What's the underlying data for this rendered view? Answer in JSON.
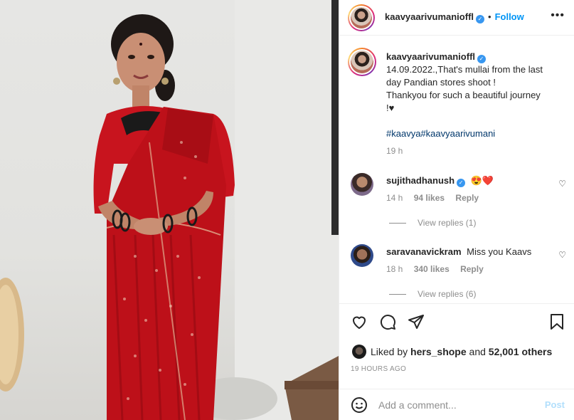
{
  "post": {
    "username": "kaavyaarivumanioffl",
    "follow_label": "Follow",
    "more_label": "•••",
    "caption": {
      "line1": "14.09.2022.,That's mullai from the last",
      "line2": "day Pandian stores shoot !",
      "line3": "Thankyou for such a beautiful journey",
      "line4": "!♥",
      "hashtags": "#kaavya#kaavyaarivumani",
      "time": "19 h"
    },
    "comments": [
      {
        "username": "sujithadhanush",
        "text": "😍❤️",
        "time": "14 h",
        "likes": "94 likes",
        "reply": "Reply",
        "view_replies": "View replies (1)"
      },
      {
        "username": "saravanavickram",
        "text": "Miss you Kaavs",
        "time": "18 h",
        "likes": "340 likes",
        "reply": "Reply",
        "view_replies": "View replies (6)"
      }
    ],
    "likes": {
      "prefix": "Liked by",
      "user": "hers_shope",
      "connector": "and",
      "others": "52,001 others"
    },
    "posted_ago": "19 HOURS AGO",
    "comment_placeholder": "Add a comment...",
    "post_label": "Post"
  },
  "colors": {
    "accent": "#0095f6",
    "verified": "#3897f0",
    "saree_red": "#c8141e",
    "muted": "#8e8e8e"
  },
  "icons": [
    "more-icon",
    "verified-icon",
    "heart-icon",
    "comment-icon",
    "share-icon",
    "bookmark-icon",
    "emoji-icon"
  ]
}
